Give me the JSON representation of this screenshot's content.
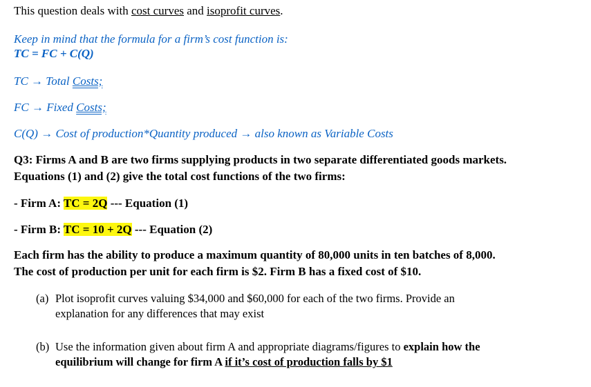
{
  "intro": {
    "prefix": "This question deals with ",
    "link1": "cost curves",
    "middle": " and ",
    "link2": "isoprofit curves",
    "suffix": "."
  },
  "reminder": {
    "line1": "Keep in mind that the formula for a firm’s cost function is:",
    "formula": "TC = FC + C(Q)"
  },
  "definitions": [
    {
      "term": "TC",
      "arrow": " → ",
      "text": "Total ",
      "underlined": "Costs;"
    },
    {
      "term": "FC",
      "arrow": " → ",
      "text": "Fixed ",
      "underlined": "Costs;"
    },
    {
      "term": "C(Q)",
      "arrow": " → ",
      "text": "Cost of production*Quantity produced ",
      "arrow2": "→ ",
      "text2": "also known as Variable Costs"
    }
  ],
  "question": {
    "line1": "Q3: Firms A and B are two firms supplying products in two separate differentiated goods markets.",
    "line2": "Equations (1) and (2) give the total cost functions of the two firms:",
    "firmA": {
      "label": "- Firm A: ",
      "equation": "TC = 2Q",
      "suffix": " --- Equation (1)"
    },
    "firmB": {
      "label": "- Firm B: ",
      "equation": "TC = 10 + 2Q",
      "suffix": " --- Equation (2)"
    },
    "info1": "Each firm has the ability to produce a maximum quantity of 80,000 units in ten batches of 8,000.",
    "info2": "The cost of production per unit for each firm is $2. Firm B has a fixed cost of $10."
  },
  "parts": [
    {
      "label": "(a)",
      "line1": "Plot isoprofit curves valuing $34,000 and $60,000 for each of the two firms. Provide an",
      "line2": "explanation for any differences that may exist"
    },
    {
      "label": "(b)",
      "line1_plain": "Use the information given about firm A and appropriate diagrams/figures to ",
      "line1_bold": "explain how the",
      "line2_bold": "equilibrium will change for firm A ",
      "line2_bold_underlined": "if it’s cost of production falls by $1"
    }
  ],
  "colors": {
    "accent_blue": "#0a62c4",
    "highlight": "#fdf70f"
  }
}
